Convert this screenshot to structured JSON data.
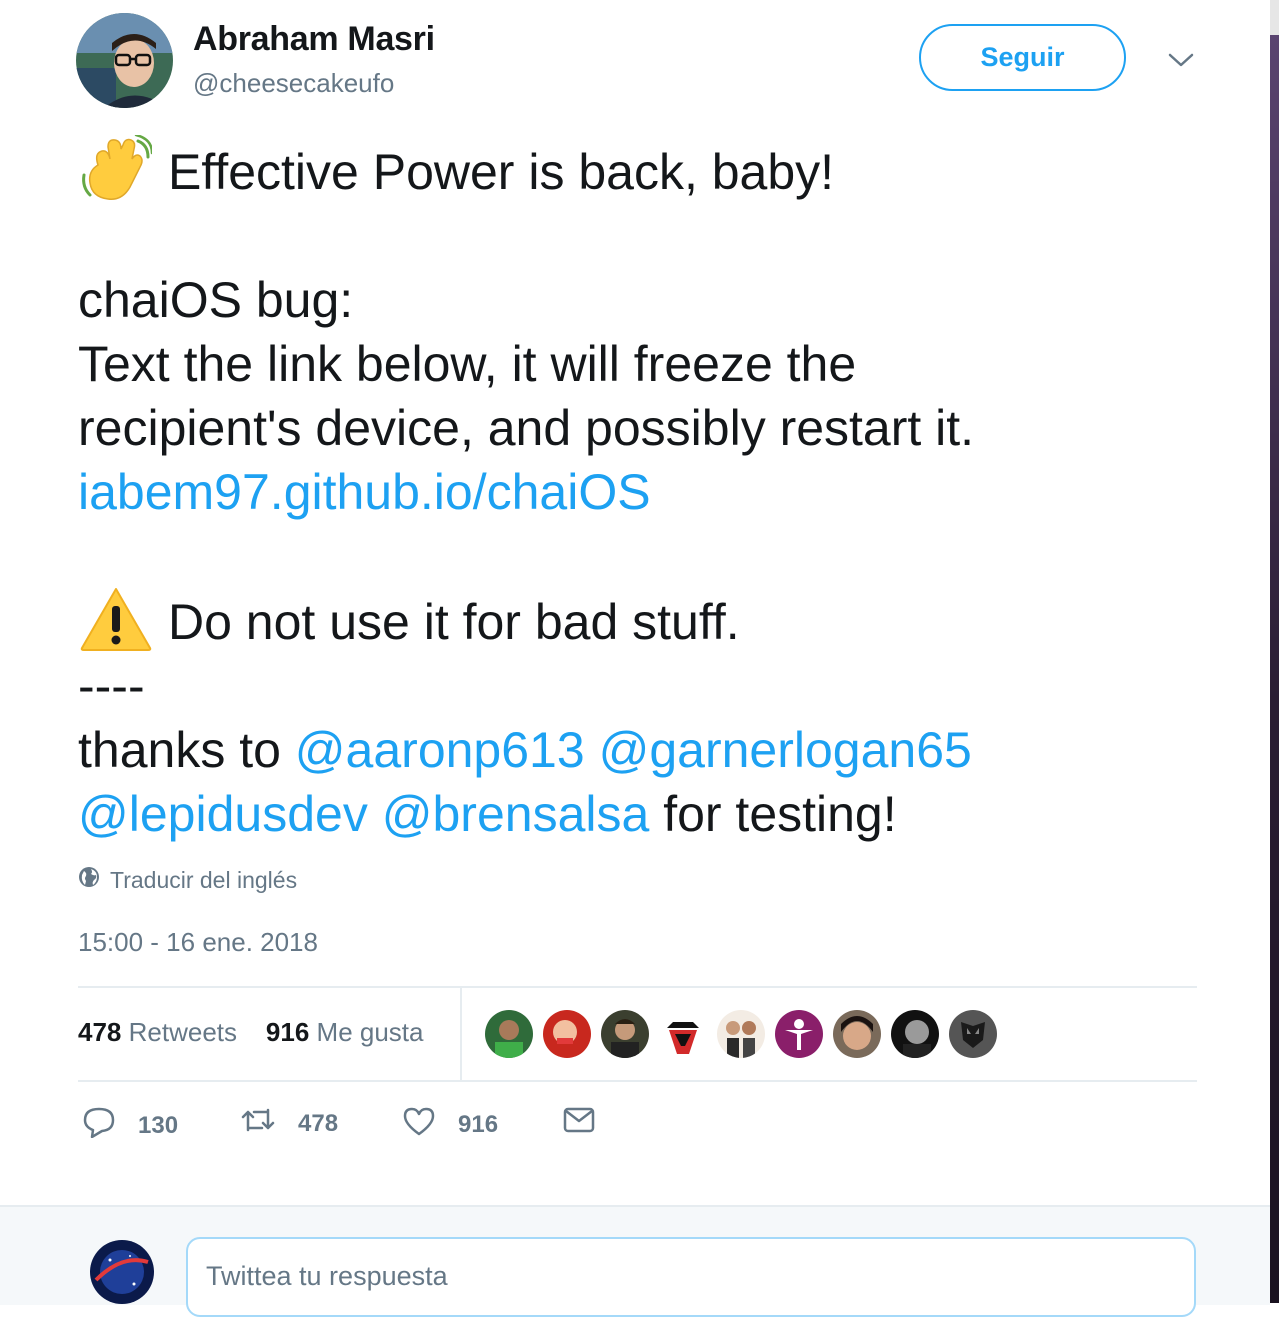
{
  "author": {
    "name": "Abraham Masri",
    "handle": "@cheesecakeufo"
  },
  "header": {
    "follow_label": "Seguir",
    "caret_icon": "chevron-down-icon"
  },
  "tweet": {
    "line1": "Effective Power is back, baby!",
    "line1_emoji": "waving-hand-icon",
    "line2": "chaiOS bug:",
    "line3": "Text the link below, it will freeze the",
    "line4": "recipient's device, and possibly restart it.",
    "link": "iabem97.github.io/chaiOS",
    "line5": "Do not use it for bad stuff.",
    "line5_emoji": "warning-icon",
    "separator": "----",
    "thanks_prefix": "thanks to ",
    "mentions": [
      "@aaronp613",
      "@garnerlogan65",
      "@lepidusdev",
      "@brensalsa"
    ],
    "thanks_suffix": " for testing!"
  },
  "translate_label": "Traducir del inglés",
  "timestamp": "15:00 - 16 ene. 2018",
  "stats": {
    "retweets_count": "478",
    "retweets_label": "Retweets",
    "likes_count": "916",
    "likes_label": "Me gusta"
  },
  "actions": {
    "reply_count": "130",
    "retweet_count": "478",
    "like_count": "916"
  },
  "reply": {
    "placeholder": "Twittea tu respuesta"
  },
  "colors": {
    "accent": "#1da1f2",
    "text": "#14171a",
    "muted": "#657786"
  }
}
